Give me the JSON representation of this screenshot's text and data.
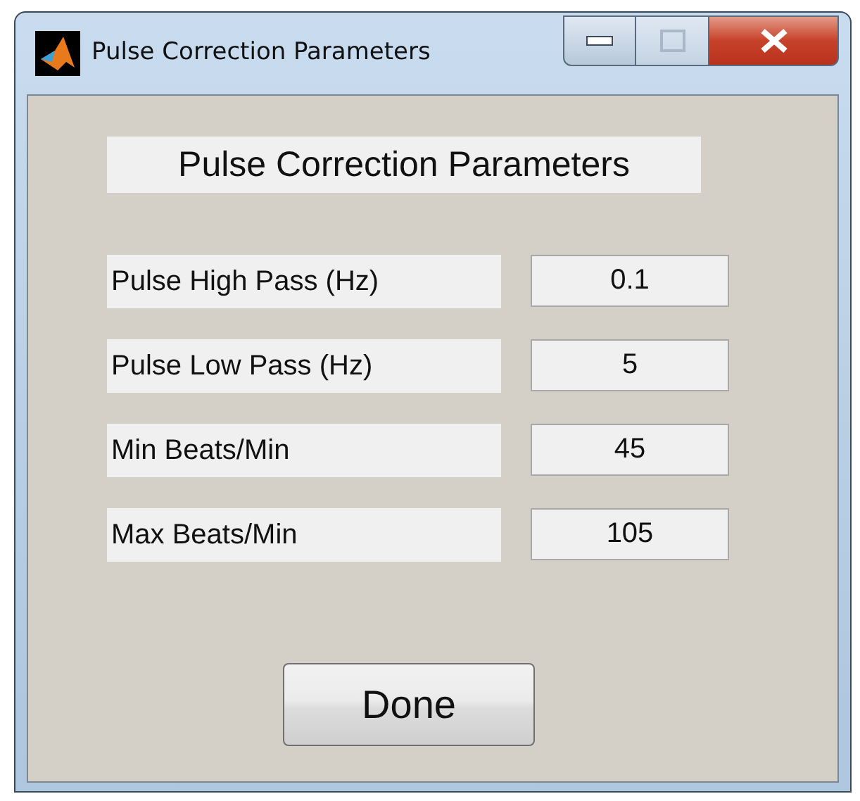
{
  "window": {
    "title": "Pulse Correction Parameters"
  },
  "heading": "Pulse Correction Parameters",
  "parameters": [
    {
      "label": "Pulse High Pass (Hz)",
      "value": "0.1"
    },
    {
      "label": "Pulse Low Pass (Hz)",
      "value": "5"
    },
    {
      "label": "Min Beats/Min",
      "value": "45"
    },
    {
      "label": "Max Beats/Min",
      "value": "105"
    }
  ],
  "buttons": [
    "Done"
  ]
}
